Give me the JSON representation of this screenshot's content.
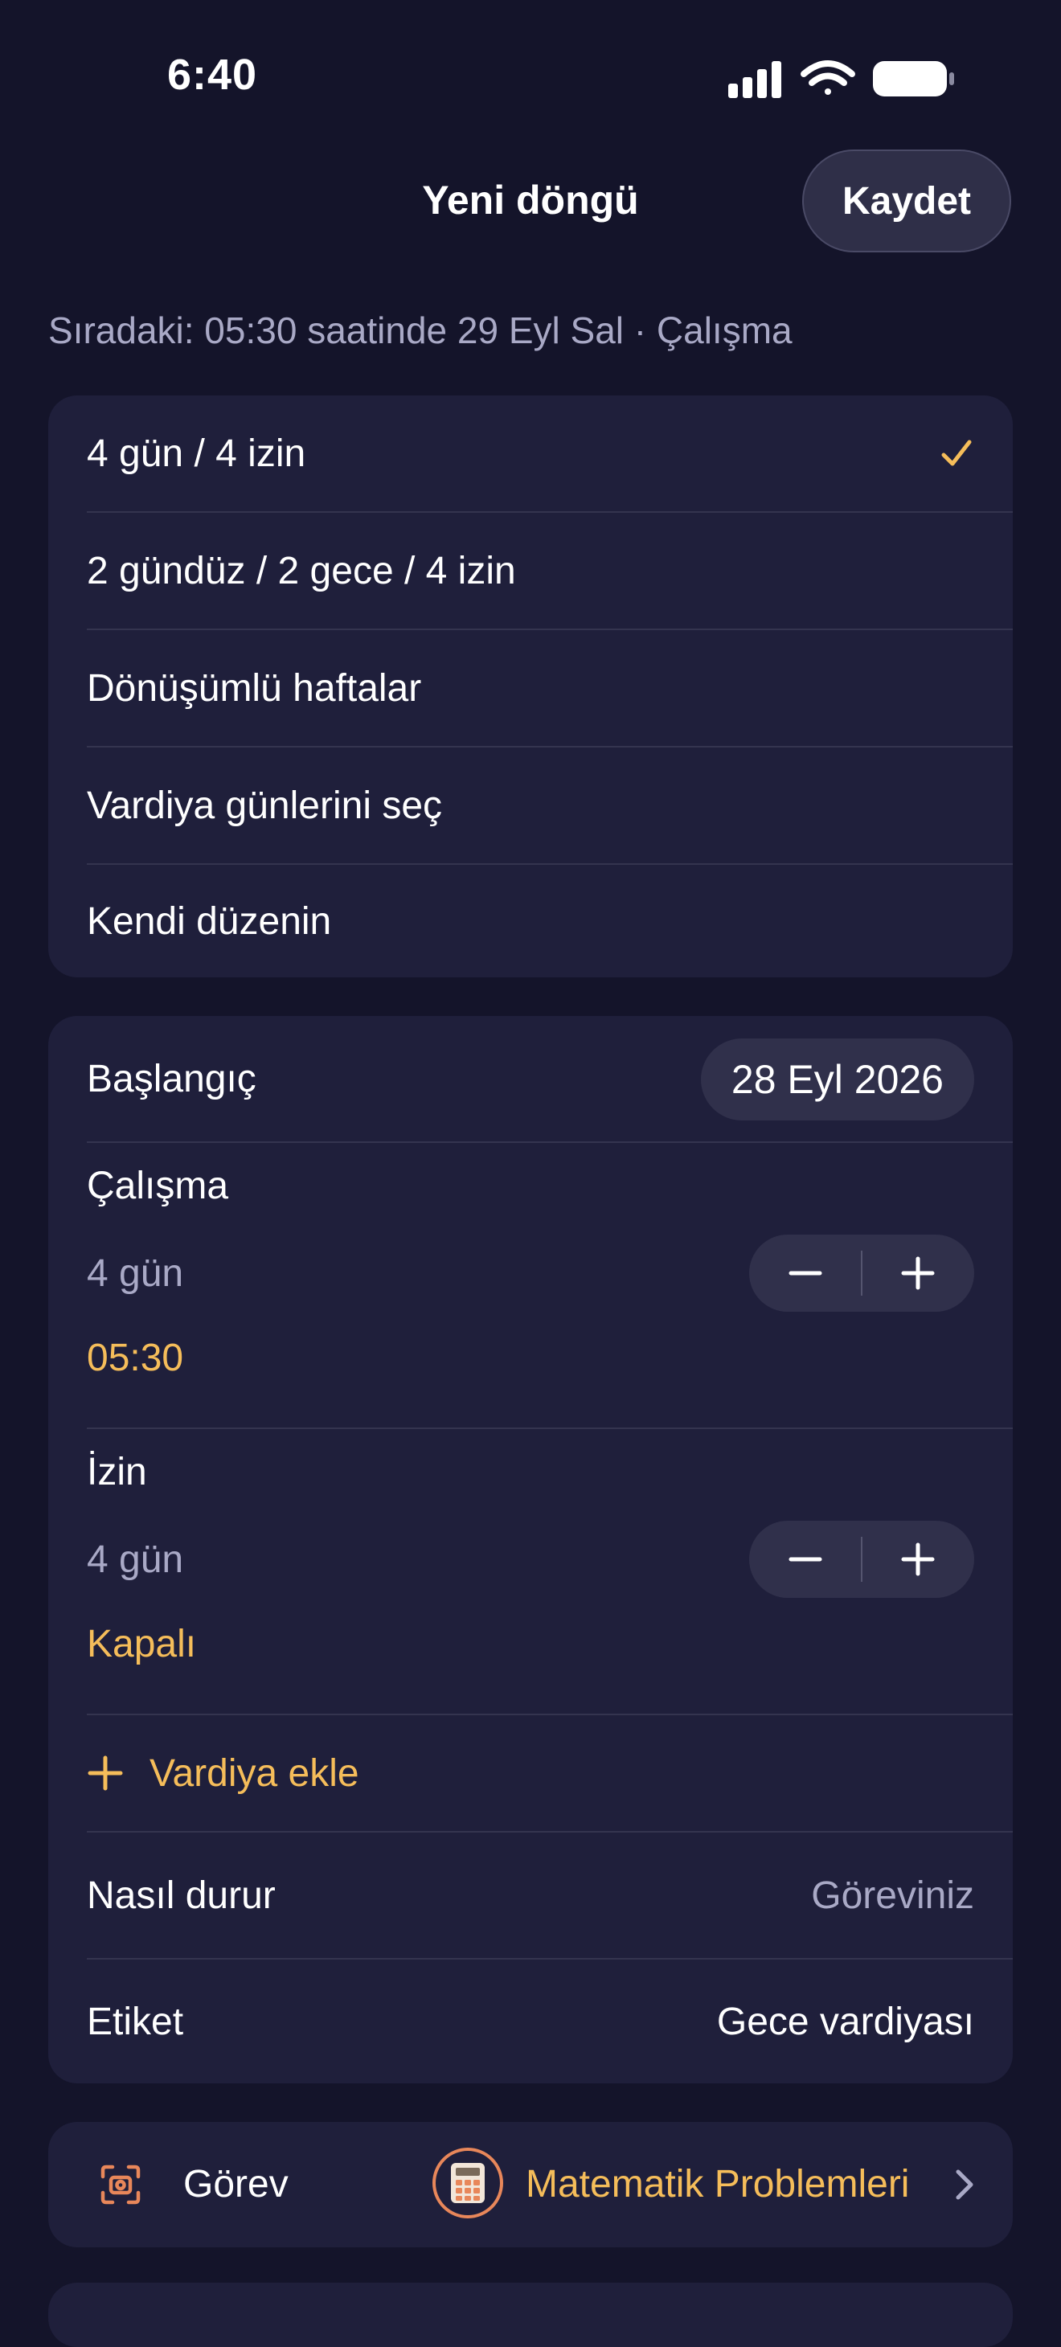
{
  "status": {
    "time": "6:40",
    "icons": [
      "cellular-signal-icon",
      "wifi-icon",
      "battery-icon"
    ]
  },
  "nav": {
    "title": "Yeni döngü",
    "save_label": "Kaydet"
  },
  "next_info": "Sıradaki: 05:30 saatinde 29 Eyl Sal · Çalışma",
  "patterns": {
    "items": [
      {
        "label": "4 gün / 4 izin",
        "selected": true
      },
      {
        "label": "2 gündüz / 2 gece / 4 izin",
        "selected": false
      },
      {
        "label": "Dönüşümlü haftalar",
        "selected": false
      },
      {
        "label": "Vardiya günlerini seç",
        "selected": false
      },
      {
        "label": "Kendi düzenin",
        "selected": false
      }
    ]
  },
  "schedule": {
    "start_label": "Başlangıç",
    "start_date": "28 Eyl 2026",
    "work": {
      "title": "Çalışma",
      "days": "4 gün",
      "alarm": "05:30"
    },
    "off": {
      "title": "İzin",
      "days": "4 gün",
      "alarm": "Kapalı"
    },
    "add_shift_label": "Vardiya ekle",
    "stop_label": "Nasıl durur",
    "stop_value": "Göreviniz",
    "tag_label": "Etiket",
    "tag_value": "Gece vardiyası"
  },
  "task": {
    "label": "Görev",
    "value": "Matematik Problemleri"
  },
  "colors": {
    "background": "#14142a",
    "card": "#1f1f3b",
    "accent": "#f5bd5a",
    "muted": "#a9a9c6",
    "task_icon": "#e8875a"
  }
}
